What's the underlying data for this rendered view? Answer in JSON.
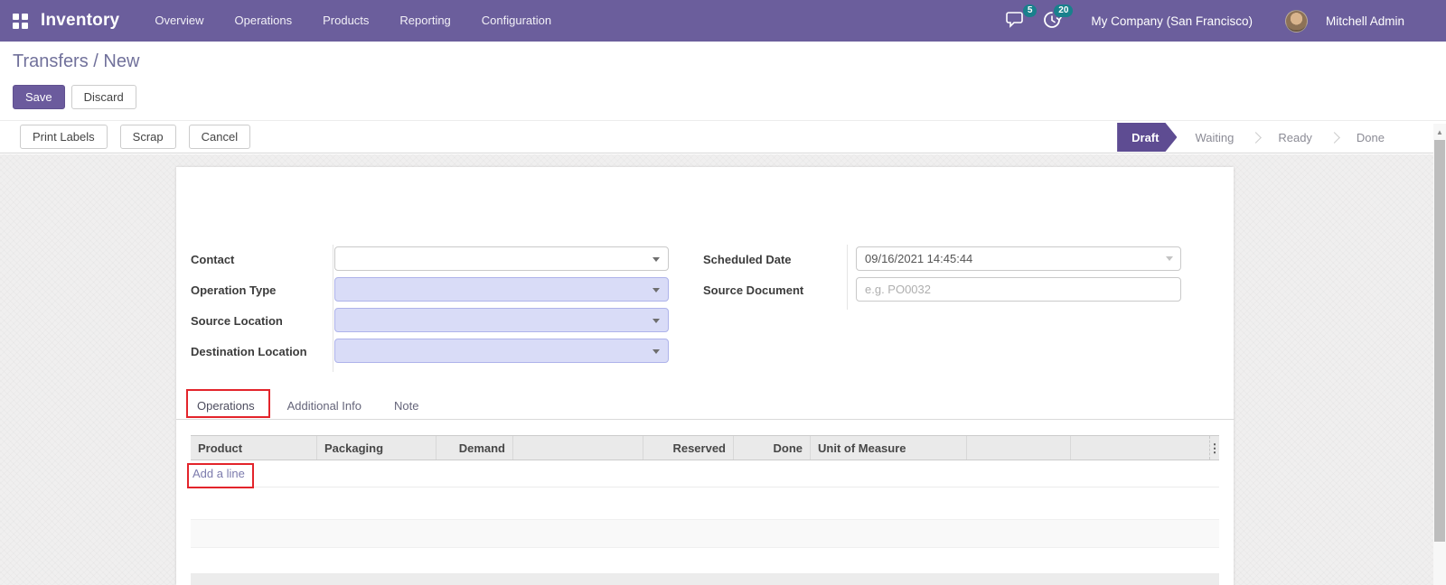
{
  "colors": {
    "nav_purple": "#6B5E9C",
    "save_purple": "#6B5B9D",
    "draft_step_purple": "#5E4C92",
    "badge_teal": "#19808C",
    "required_field_lavender": "#D9DCF7",
    "link_purple": "#7C7BAD",
    "annotation_red": "#E3242B"
  },
  "nav": {
    "app_name": "Inventory",
    "menus": [
      "Overview",
      "Operations",
      "Products",
      "Reporting",
      "Configuration"
    ],
    "messages_badge": "5",
    "activities_badge": "20",
    "company": "My Company (San Francisco)",
    "user": "Mitchell Admin"
  },
  "breadcrumb": {
    "parent": "Transfers",
    "separator": " / ",
    "current": "New"
  },
  "header_actions": {
    "save": "Save",
    "discard": "Discard"
  },
  "toolbar": {
    "print_labels": "Print Labels",
    "scrap": "Scrap",
    "cancel": "Cancel"
  },
  "statusbar": {
    "steps": [
      "Draft",
      "Waiting",
      "Ready",
      "Done"
    ],
    "active_step": "Draft"
  },
  "form": {
    "contact": {
      "label": "Contact",
      "value": ""
    },
    "operation_type": {
      "label": "Operation Type",
      "value": ""
    },
    "source_location": {
      "label": "Source Location",
      "value": ""
    },
    "destination_location": {
      "label": "Destination Location",
      "value": ""
    },
    "scheduled_date": {
      "label": "Scheduled Date",
      "value": "09/16/2021 14:45:44"
    },
    "source_document": {
      "label": "Source Document",
      "placeholder": "e.g. PO0032"
    }
  },
  "tabs": [
    "Operations",
    "Additional Info",
    "Note"
  ],
  "operations_table": {
    "columns": [
      "Product",
      "Packaging",
      "Demand",
      "",
      "Reserved",
      "Done",
      "Unit of Measure",
      "",
      ""
    ],
    "add_line_label": "Add a line"
  },
  "icons": {
    "kebab": "⋮",
    "scroll_up": "▲"
  }
}
